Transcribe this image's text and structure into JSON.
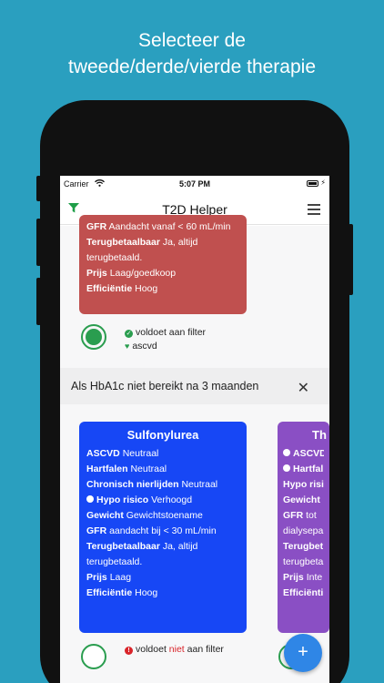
{
  "headline": {
    "line1": "Selecteer de",
    "line2": "tweede/derde/vierde therapie"
  },
  "status_bar": {
    "carrier": "Carrier",
    "time": "5:07 PM"
  },
  "navbar": {
    "title": "T2D Helper"
  },
  "top_card": {
    "rows": [
      {
        "label": "GFR",
        "value": "Aandacht vanaf < 60 mL/min"
      },
      {
        "label": "Terugbetaalbaar",
        "value": "Ja, altijd"
      },
      {
        "label": "",
        "value": "terugbetaald."
      },
      {
        "label": "Prijs",
        "value": "Laag/goedkoop"
      },
      {
        "label": "Efficiëntie",
        "value": "Hoog"
      }
    ],
    "filter_status": "voldoet aan filter",
    "tag": "ascvd"
  },
  "section": {
    "title": "Als HbA1c niet bereikt na 3 maanden"
  },
  "cards": [
    {
      "title": "Sulfonylurea",
      "rows": [
        {
          "label": "ASCVD",
          "value": "Neutraal"
        },
        {
          "label": "Hartfalen",
          "value": "Neutraal"
        },
        {
          "label": "Chronisch nierlijden",
          "value": "Neutraal"
        },
        {
          "label": "Hypo risico",
          "value": "Verhoogd"
        },
        {
          "label": "Gewicht",
          "value": "Gewichtstoename"
        },
        {
          "label": "GFR",
          "value": "aandacht bij < 30 mL/min"
        },
        {
          "label": "Terugbetaalbaar",
          "value": "Ja, altijd"
        },
        {
          "label": "",
          "value": "terugbetaald."
        },
        {
          "label": "Prijs",
          "value": "Laag"
        },
        {
          "label": "Efficiëntie",
          "value": "Hoog"
        }
      ],
      "filter_status_prefix": "voldoet",
      "filter_status_neg": "niet",
      "filter_status_suffix": "aan filter"
    },
    {
      "title": "Th",
      "rows": [
        {
          "label": "ASCVD",
          "value": ""
        },
        {
          "label": "Hartfal",
          "value": ""
        },
        {
          "label": "Hypo risi",
          "value": ""
        },
        {
          "label": "Gewicht",
          "value": ""
        },
        {
          "label": "GFR",
          "value": "tot"
        },
        {
          "label": "",
          "value": "dialysepa"
        },
        {
          "label": "Terugbet",
          "value": ""
        },
        {
          "label": "",
          "value": "terugbeta"
        },
        {
          "label": "Prijs",
          "value": "Inte"
        },
        {
          "label": "Efficiënti",
          "value": ""
        }
      ]
    }
  ],
  "fab": {
    "label": "+"
  },
  "colors": {
    "background": "#2a9fbf",
    "red_card": "#c0504f",
    "blue_card": "#1747f5",
    "purple_card": "#8a4fc4",
    "ok_green": "#2a9d4f",
    "error_red": "#d9242a",
    "fab_blue": "#2f86e6"
  }
}
